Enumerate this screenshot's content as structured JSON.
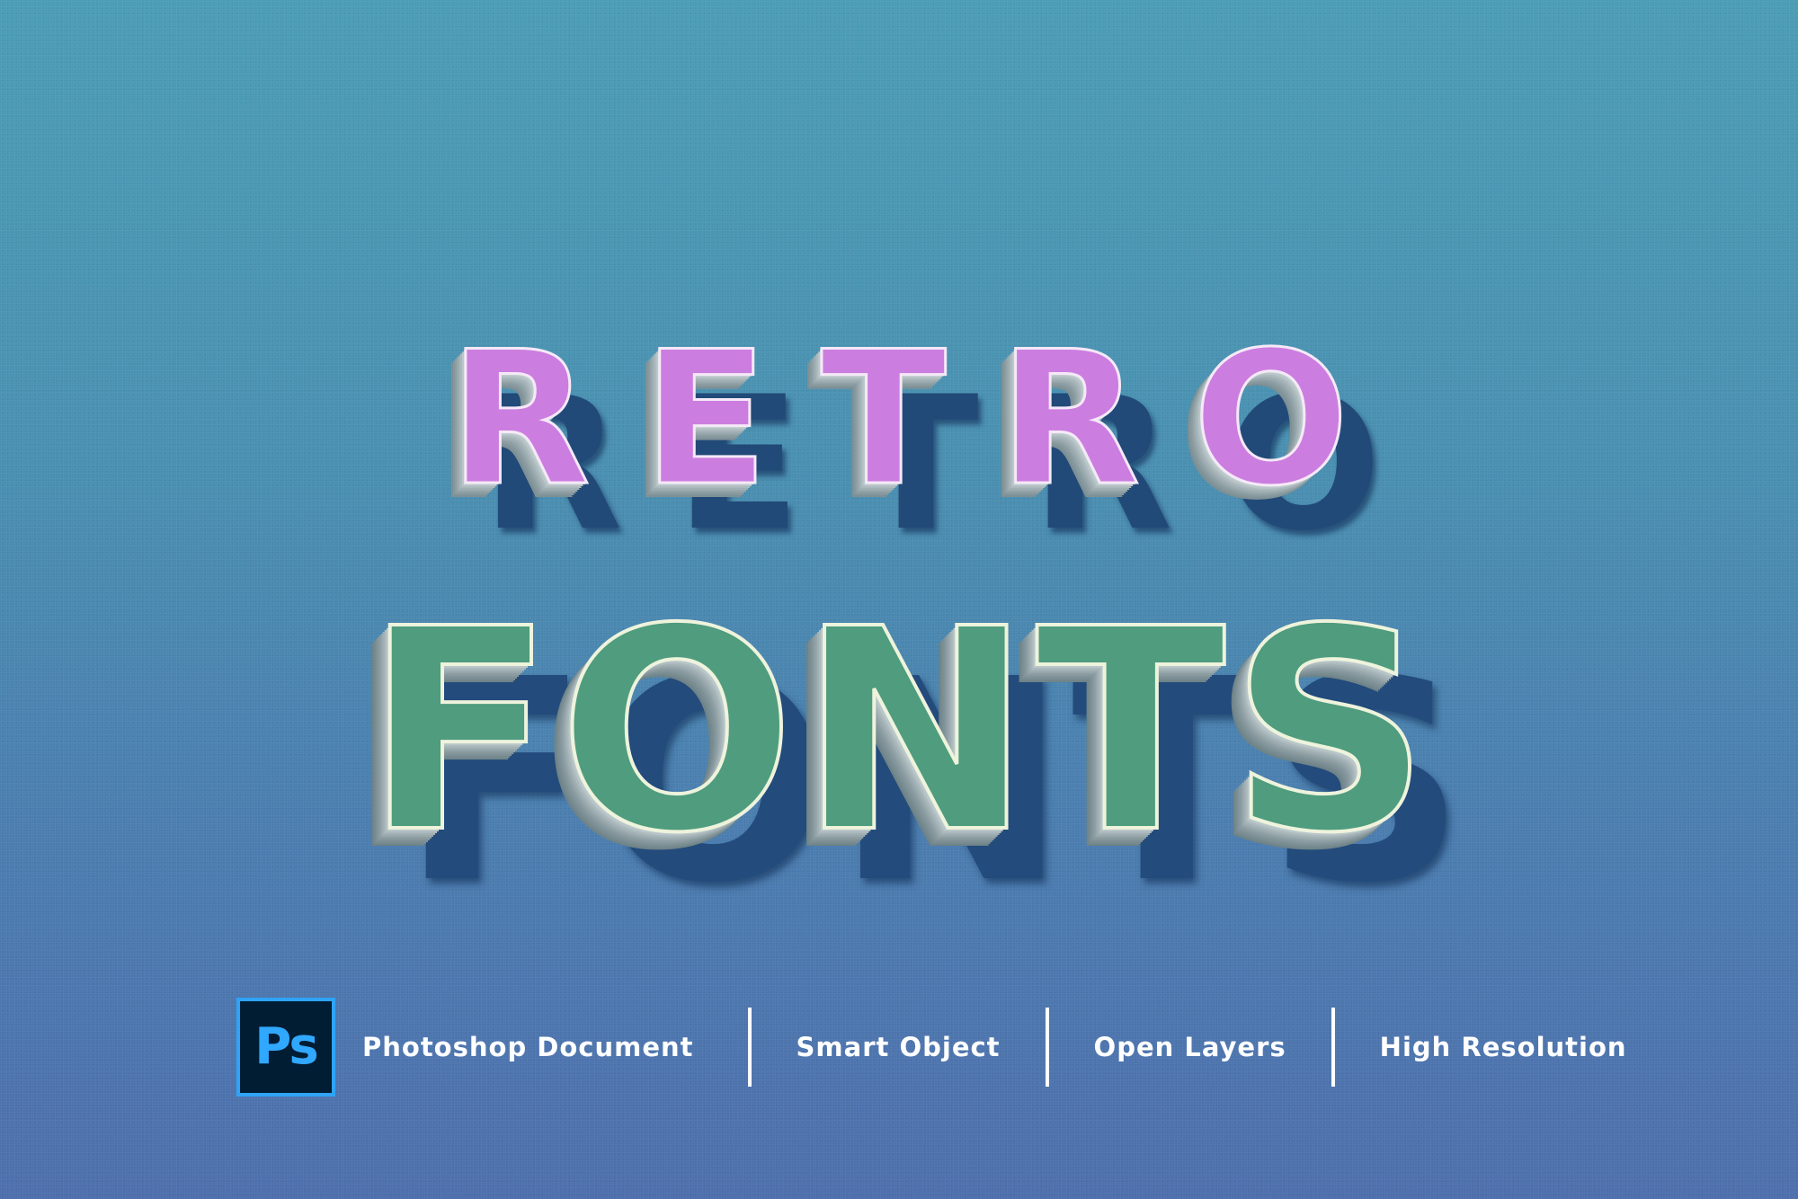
{
  "headline": {
    "line1": "RETRO",
    "line2": "FONTS"
  },
  "features": {
    "app_icon_text": "Ps",
    "items": [
      "Photoshop Document",
      "Smart Object",
      "Open Layers",
      "High Resolution"
    ]
  },
  "colors": {
    "background_top": "#4b9db5",
    "background_bottom": "#4e6fad",
    "retro_fill": "#cc7ee0",
    "fonts_fill": "#4f9c7e",
    "extrusion": "#a1b0b4",
    "shadow": "#214a78",
    "ps_icon_bg": "#001d34",
    "ps_icon_accent": "#31a8ff"
  }
}
